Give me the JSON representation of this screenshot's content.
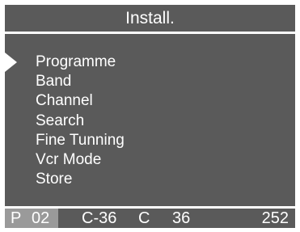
{
  "title": "Install.",
  "menu": {
    "selected_index": 0,
    "items": [
      {
        "label": "Programme"
      },
      {
        "label": "Band"
      },
      {
        "label": "Channel"
      },
      {
        "label": "Search"
      },
      {
        "label": "Fine Tunning"
      },
      {
        "label": "Vcr Mode"
      },
      {
        "label": "Store"
      }
    ]
  },
  "status": {
    "program_letter": "P",
    "program_number": "02",
    "channel_code": "C-36",
    "channel_letter": "C",
    "channel_number": "36",
    "count": "252"
  },
  "colors": {
    "background": "#5a5a5a",
    "text": "#ffffff",
    "separator": "#ffffff",
    "program_box": "#9a9a9a"
  },
  "icons": {
    "cursor": "right-triangle-pointer"
  }
}
